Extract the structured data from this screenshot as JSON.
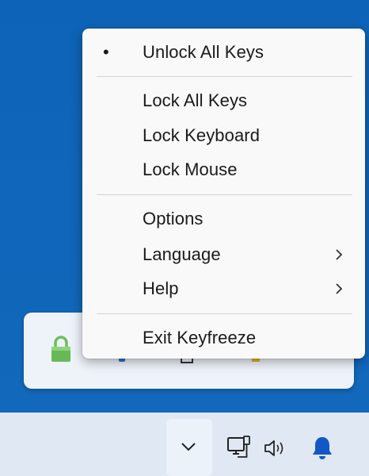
{
  "menu": {
    "items": [
      {
        "label": "Unlock All Keys",
        "checked": true
      },
      {
        "label": "Lock All Keys"
      },
      {
        "label": "Lock Keyboard"
      },
      {
        "label": "Lock Mouse"
      },
      {
        "label": "Options"
      },
      {
        "label": "Language",
        "submenu": true
      },
      {
        "label": "Help",
        "submenu": true
      },
      {
        "label": "Exit Keyfreeze"
      }
    ],
    "bullet": "•"
  },
  "tray_flyout": {
    "icons": [
      "keyfreeze-lock-icon",
      "app-icon",
      "app-icon",
      "app-icon"
    ]
  },
  "taskbar": {
    "icons": [
      "chevron-up-icon",
      "network-icon",
      "volume-icon",
      "notification-bell-icon"
    ]
  },
  "colors": {
    "desktop": "#0f67bc",
    "menu_bg": "#f9f9f9",
    "taskbar_bg": "#dfe8f3",
    "bell": "#1257c6",
    "lock_green": "#5fb54a"
  }
}
